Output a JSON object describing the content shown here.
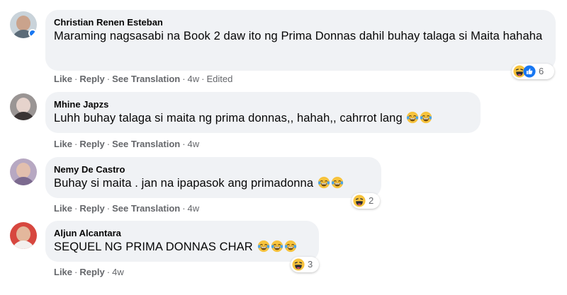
{
  "comments": [
    {
      "author": "Christian Renen Esteban",
      "text": "Maraming nagsasabi na Book 2 daw ito ng Prima Donnas dahil buhay talaga si Maita hahaha",
      "actions": {
        "like": "Like",
        "reply": "Reply",
        "translation": "See Translation",
        "time": "4w",
        "edited": "Edited"
      },
      "reaction_count": "6",
      "reactions": [
        "haha-emoji",
        "like-emoji"
      ]
    },
    {
      "author": "Mhine Japzs",
      "text": "Luhh buhay talaga si maita ng prima donnas,, hahah,, cahrrot lang",
      "emojis": [
        "laughing-crying-emoji",
        "laughing-crying-emoji"
      ],
      "actions": {
        "like": "Like",
        "reply": "Reply",
        "translation": "See Translation",
        "time": "4w"
      }
    },
    {
      "author": "Nemy De Castro",
      "text": "Buhay si maita . jan na ipapasok ang primadonna",
      "emojis": [
        "laughing-crying-emoji",
        "laughing-crying-emoji"
      ],
      "actions": {
        "like": "Like",
        "reply": "Reply",
        "translation": "See Translation",
        "time": "4w"
      },
      "reaction_count": "2",
      "reactions": [
        "haha-emoji"
      ]
    },
    {
      "author": "Aljun Alcantara",
      "text": "SEQUEL NG PRIMA DONNAS CHAR",
      "emojis": [
        "laughing-crying-emoji",
        "laughing-crying-emoji",
        "laughing-crying-emoji"
      ],
      "actions": {
        "like": "Like",
        "reply": "Reply",
        "time": "4w"
      },
      "reaction_count": "3",
      "reactions": [
        "haha-emoji"
      ]
    }
  ],
  "colors": {
    "bubble": "#f0f2f5",
    "meta_text": "#65676b",
    "name_text": "#050505",
    "haha_yellow": "#f7b928",
    "like_blue": "#1877f2"
  }
}
